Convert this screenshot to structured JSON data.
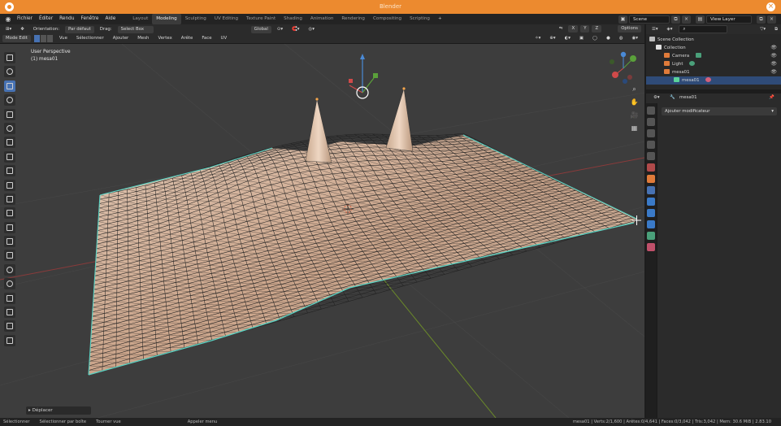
{
  "window": {
    "title": "Blender"
  },
  "menu": [
    "Fichier",
    "Éditer",
    "Rendu",
    "Fenêtre",
    "Aide"
  ],
  "workspaces": [
    "Layout",
    "Modeling",
    "Sculpting",
    "UV Editing",
    "Texture Paint",
    "Shading",
    "Animation",
    "Rendering",
    "Compositing",
    "Scripting",
    "+"
  ],
  "active_workspace": "Modeling",
  "scene": {
    "name": "Scene",
    "view_layer": "View Layer"
  },
  "header2": {
    "orientation_label": "Orientation:",
    "orientation_value": "Par défaut",
    "drag_label": "Drag:",
    "drag_value": "Select Box",
    "transform": "Global",
    "xyz": [
      "X",
      "Y",
      "Z"
    ],
    "options": "Options"
  },
  "header3": {
    "mode": "Mode Edit",
    "menus": [
      "Vue",
      "Sélectionner",
      "Ajouter",
      "Mesh",
      "Vertex",
      "Arête",
      "Face",
      "UV"
    ]
  },
  "viewport": {
    "view_name": "User Perspective",
    "object_info": "(1) mesa01"
  },
  "last_operator": "Déplacer",
  "outliner": {
    "search_placeholder": "",
    "rows": [
      {
        "label": "Scene Collection",
        "icon_color": "#bbbbbb",
        "indent": 0
      },
      {
        "label": "Collection",
        "icon_color": "#e0e0e0",
        "indent": 1
      },
      {
        "label": "Camera",
        "icon_color": "#e07b3a",
        "indent": 2
      },
      {
        "label": "Light",
        "icon_color": "#e07b3a",
        "indent": 2
      },
      {
        "label": "mesa01",
        "icon_color": "#e07b3a",
        "indent": 2
      },
      {
        "label": "mesa01",
        "icon_color": "#5ad39a",
        "indent": 3
      }
    ]
  },
  "properties": {
    "object_name": "mesa01",
    "add_modifier": "Ajouter modificateur"
  },
  "status": {
    "left": [
      "Sélectionner",
      "Sélectionner par boîte",
      "Tourner vue",
      "Appeler menu"
    ],
    "right": "mesa01 | Verts:2/1,600 | Arêtes:0/4,641 | Faces:0/3,042 | Tris:3,042 | Mem: 30.6 MiB | 2.83.10"
  },
  "colors": {
    "accent": "#4772b3",
    "title_bar": "#ec8a2f",
    "mesh_fill": "#d8b9a3",
    "wire": "#1a1a1a",
    "selected_edge": "#5ad3c4"
  }
}
